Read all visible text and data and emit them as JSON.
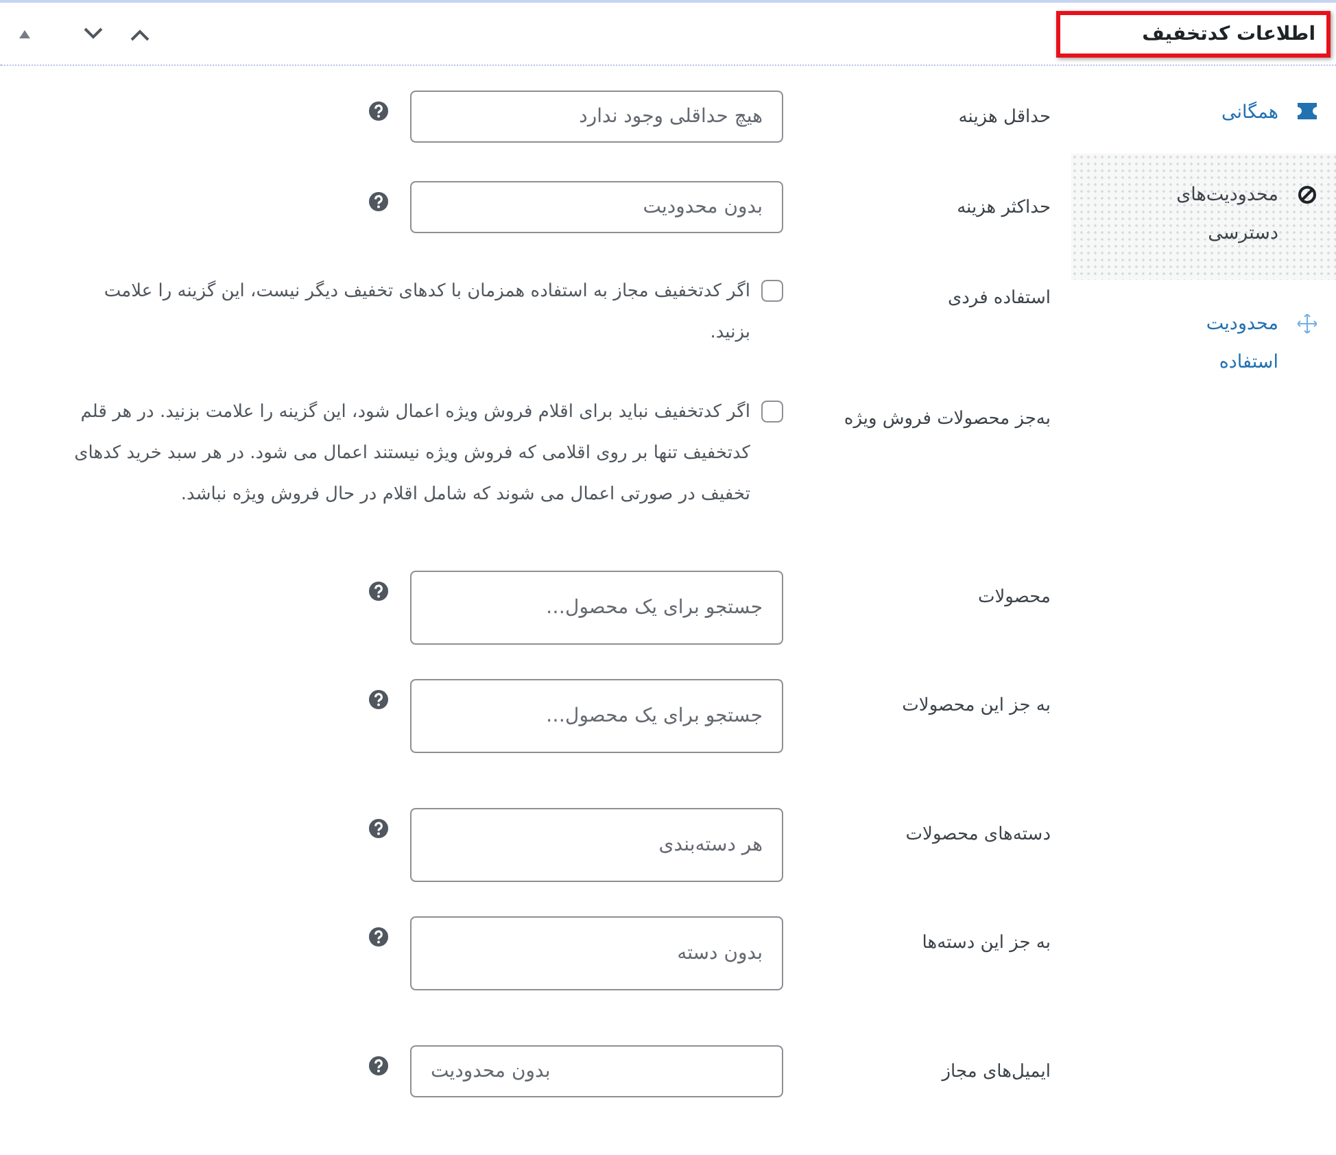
{
  "panel": {
    "title": "اطلاعات کدتخفیف",
    "title_highlighted": true
  },
  "sidebar": {
    "items": [
      {
        "label": "همگانی",
        "selected": false
      },
      {
        "label": "محدودیت‌های دسترسی",
        "selected": true
      },
      {
        "label": "محدودیت استفاده",
        "selected": false
      }
    ]
  },
  "groups": [
    {
      "fields": [
        {
          "kind": "text",
          "label": "حداقل هزینه",
          "placeholder": "هیچ حداقلی وجود ندارد"
        },
        {
          "kind": "text",
          "label": "حداکثر هزینه",
          "placeholder": "بدون محدودیت"
        },
        {
          "kind": "checkbox",
          "label": "استفاده فردی",
          "checked": false,
          "description": "اگر کدتخفیف مجاز به استفاده همزمان با کدهای تخفیف دیگر نیست، این گزینه را علامت بزنید."
        },
        {
          "kind": "checkbox",
          "label": "به‌جز محصولات فروش ویژه",
          "checked": false,
          "description": "اگر کدتخفیف نباید برای اقلام فروش ویژه اعمال شود، این گزینه را علامت بزنید. در هر قلم کدتخفیف تنها بر روی اقلامی که فروش ویژه نیستند اعمال می شود. در هر سبد خرید کدهای تخفیف در صورتی اعمال می شوند که شامل اقلام در حال فروش ویژه نباشد."
        }
      ]
    },
    {
      "fields": [
        {
          "kind": "multiselect",
          "label": "محصولات",
          "placeholder": "جستجو برای یک محصول…"
        },
        {
          "kind": "multiselect",
          "label": "به جز این محصولات",
          "placeholder": "جستجو برای یک محصول…"
        }
      ]
    },
    {
      "fields": [
        {
          "kind": "multiselect",
          "label": "دسته‌های محصولات",
          "placeholder": "هر دسته‌بندی"
        },
        {
          "kind": "multiselect",
          "label": "به جز این دسته‌ها",
          "placeholder": "بدون دسته"
        }
      ]
    },
    {
      "fields": [
        {
          "kind": "email",
          "label": "ایمیل‌های مجاز",
          "placeholder": "بدون محدودیت"
        }
      ]
    }
  ]
}
